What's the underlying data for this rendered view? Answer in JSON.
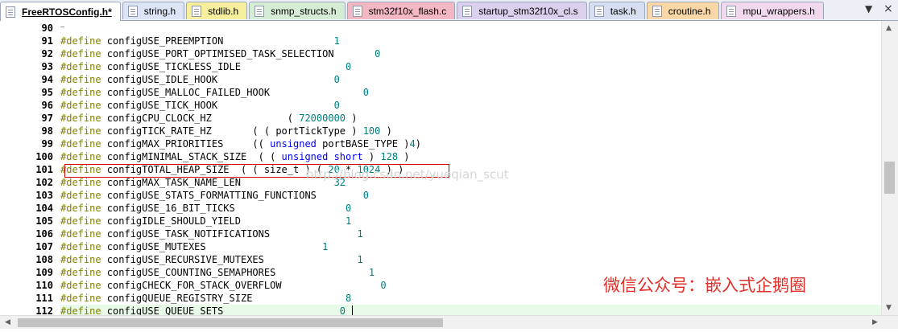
{
  "tabs": [
    {
      "label": "FreeRTOSConfig.h*",
      "color": "#ffffff",
      "active": true
    },
    {
      "label": "string.h",
      "color": "#dde4f6",
      "active": false
    },
    {
      "label": "stdlib.h",
      "color": "#f7ef9c",
      "active": false
    },
    {
      "label": "snmp_structs.h",
      "color": "#d5ecd5",
      "active": false
    },
    {
      "label": "stm32f10x_flash.c",
      "color": "#f4b8c4",
      "active": false
    },
    {
      "label": "startup_stm32f10x_cl.s",
      "color": "#dcd0ef",
      "active": false
    },
    {
      "label": "task.h",
      "color": "#d7def2",
      "active": false
    },
    {
      "label": "croutine.h",
      "color": "#fad7a6",
      "active": false
    },
    {
      "label": "mpu_wrappers.h",
      "color": "#f2d8ec",
      "active": false
    }
  ],
  "tab_controls": {
    "dropdown": "▼",
    "close": "×"
  },
  "code_lines": [
    {
      "num": "90",
      "segments": []
    },
    {
      "num": "91",
      "segments": [
        {
          "t": "#define",
          "c": "kw"
        },
        {
          "t": " configUSE_PREEMPTION                   ",
          "c": ""
        },
        {
          "t": "1",
          "c": "num"
        }
      ]
    },
    {
      "num": "92",
      "segments": [
        {
          "t": "#define",
          "c": "kw"
        },
        {
          "t": " configUSE_PORT_OPTIMISED_TASK_SELECTION       ",
          "c": ""
        },
        {
          "t": "0",
          "c": "num"
        }
      ]
    },
    {
      "num": "93",
      "segments": [
        {
          "t": "#define",
          "c": "kw"
        },
        {
          "t": " configUSE_TICKLESS_IDLE                  ",
          "c": ""
        },
        {
          "t": "0",
          "c": "num"
        }
      ]
    },
    {
      "num": "94",
      "segments": [
        {
          "t": "#define",
          "c": "kw"
        },
        {
          "t": " configUSE_IDLE_HOOK                    ",
          "c": ""
        },
        {
          "t": "0",
          "c": "num"
        }
      ]
    },
    {
      "num": "95",
      "segments": [
        {
          "t": "#define",
          "c": "kw"
        },
        {
          "t": " configUSE_MALLOC_FAILED_HOOK                ",
          "c": ""
        },
        {
          "t": "0",
          "c": "num"
        }
      ]
    },
    {
      "num": "96",
      "segments": [
        {
          "t": "#define",
          "c": "kw"
        },
        {
          "t": " configUSE_TICK_HOOK                    ",
          "c": ""
        },
        {
          "t": "0",
          "c": "num"
        }
      ]
    },
    {
      "num": "97",
      "segments": [
        {
          "t": "#define",
          "c": "kw"
        },
        {
          "t": " configCPU_CLOCK_HZ             ( ",
          "c": ""
        },
        {
          "t": "72000000",
          "c": "num"
        },
        {
          "t": " )",
          "c": ""
        }
      ]
    },
    {
      "num": "98",
      "segments": [
        {
          "t": "#define",
          "c": "kw"
        },
        {
          "t": " configTICK_RATE_HZ       ( ( portTickType ) ",
          "c": ""
        },
        {
          "t": "100",
          "c": "num"
        },
        {
          "t": " )",
          "c": ""
        }
      ]
    },
    {
      "num": "99",
      "segments": [
        {
          "t": "#define",
          "c": "kw"
        },
        {
          "t": " configMAX_PRIORITIES     (( ",
          "c": ""
        },
        {
          "t": "unsigned",
          "c": "type"
        },
        {
          "t": " portBASE_TYPE )",
          "c": ""
        },
        {
          "t": "4",
          "c": "num"
        },
        {
          "t": ")",
          "c": ""
        }
      ]
    },
    {
      "num": "100",
      "segments": [
        {
          "t": "#define",
          "c": "kw"
        },
        {
          "t": " configMINIMAL_STACK_SIZE  ( ( ",
          "c": ""
        },
        {
          "t": "unsigned short",
          "c": "type"
        },
        {
          "t": " ) ",
          "c": ""
        },
        {
          "t": "128",
          "c": "num"
        },
        {
          "t": " )",
          "c": ""
        }
      ]
    },
    {
      "num": "101",
      "segments": [
        {
          "t": "#define",
          "c": "kw"
        },
        {
          "t": " configTOTAL_HEAP_SIZE  ( ( size_t ) ( ",
          "c": ""
        },
        {
          "t": "20",
          "c": "num"
        },
        {
          "t": " * ",
          "c": ""
        },
        {
          "t": "1024",
          "c": "num"
        },
        {
          "t": " ) )",
          "c": ""
        }
      ]
    },
    {
      "num": "102",
      "segments": [
        {
          "t": "#define",
          "c": "kw"
        },
        {
          "t": " configMAX_TASK_NAME_LEN                ",
          "c": ""
        },
        {
          "t": "32",
          "c": "num"
        }
      ]
    },
    {
      "num": "103",
      "segments": [
        {
          "t": "#define",
          "c": "kw"
        },
        {
          "t": " configUSE_STATS_FORMATTING_FUNCTIONS        ",
          "c": ""
        },
        {
          "t": "0",
          "c": "num"
        }
      ]
    },
    {
      "num": "104",
      "segments": [
        {
          "t": "#define",
          "c": "kw"
        },
        {
          "t": " configUSE_16_BIT_TICKS                   ",
          "c": ""
        },
        {
          "t": "0",
          "c": "num"
        }
      ]
    },
    {
      "num": "105",
      "segments": [
        {
          "t": "#define",
          "c": "kw"
        },
        {
          "t": " configIDLE_SHOULD_YIELD                  ",
          "c": ""
        },
        {
          "t": "1",
          "c": "num"
        }
      ]
    },
    {
      "num": "106",
      "segments": [
        {
          "t": "#define",
          "c": "kw"
        },
        {
          "t": " configUSE_TASK_NOTIFICATIONS               ",
          "c": ""
        },
        {
          "t": "1",
          "c": "num"
        }
      ]
    },
    {
      "num": "107",
      "segments": [
        {
          "t": "#define",
          "c": "kw"
        },
        {
          "t": " configUSE_MUTEXES                    ",
          "c": ""
        },
        {
          "t": "1",
          "c": "num"
        }
      ]
    },
    {
      "num": "108",
      "segments": [
        {
          "t": "#define",
          "c": "kw"
        },
        {
          "t": " configUSE_RECURSIVE_MUTEXES                ",
          "c": ""
        },
        {
          "t": "1",
          "c": "num"
        }
      ]
    },
    {
      "num": "109",
      "segments": [
        {
          "t": "#define",
          "c": "kw"
        },
        {
          "t": " configUSE_COUNTING_SEMAPHORES                ",
          "c": ""
        },
        {
          "t": "1",
          "c": "num"
        }
      ]
    },
    {
      "num": "110",
      "segments": [
        {
          "t": "#define",
          "c": "kw"
        },
        {
          "t": " configCHECK_FOR_STACK_OVERFLOW                 ",
          "c": ""
        },
        {
          "t": "0",
          "c": "num"
        }
      ]
    },
    {
      "num": "111",
      "segments": [
        {
          "t": "#define",
          "c": "kw"
        },
        {
          "t": " configQUEUE_REGISTRY_SIZE                ",
          "c": ""
        },
        {
          "t": "8",
          "c": "num"
        }
      ]
    },
    {
      "num": "112",
      "segments": [
        {
          "t": "#define",
          "c": "kw"
        },
        {
          "t": " configUSE_QUEUE_SETS                    ",
          "c": ""
        },
        {
          "t": "0",
          "c": "num"
        }
      ]
    }
  ],
  "current_line": "112",
  "highlighted_line": "101",
  "watermark": "http://blog.csdn.net/yueqian_scut",
  "brand_text": "微信公众号：嵌入式企鹅圈",
  "colors": {
    "keyword": "#808000",
    "number": "#008080",
    "type": "#0000ff",
    "highlight_border": "#d00000",
    "brand": "#e0302a",
    "current_line_bg": "#e8fbe8"
  }
}
